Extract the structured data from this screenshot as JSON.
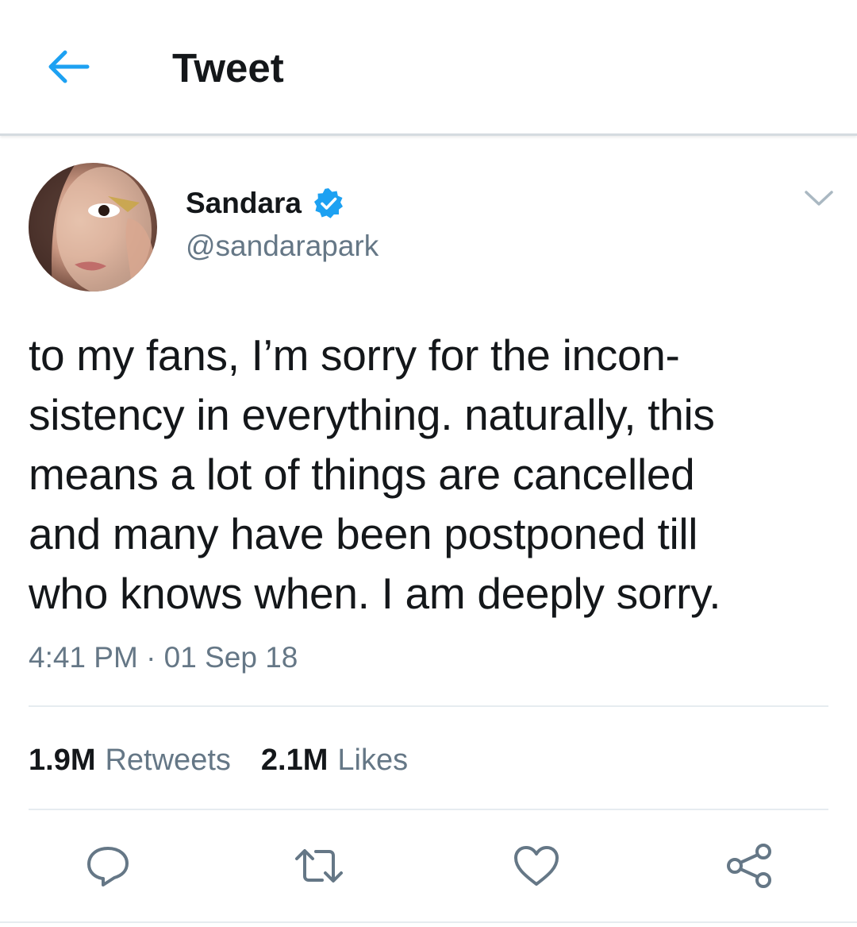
{
  "header": {
    "title": "Tweet",
    "back_icon": "arrow-left-icon",
    "accent_color": "#1da1f2"
  },
  "author": {
    "display_name": "Sandara",
    "handle": "@sandarapark",
    "verified": true,
    "verified_color": "#1da1f2",
    "avatar_icon": "avatar-photo"
  },
  "tweet": {
    "text": "to my fans, I’m sorry for the incon-\nsistency in everything. naturally, this\nmeans a lot of things are cancelled\nand many have been postponed till\nwho knows when. I am deeply sorry.",
    "timestamp": "4:41 PM · 01 Sep 18"
  },
  "stats": {
    "retweets_count": "1.9M",
    "retweets_label": "Retweets",
    "likes_count": "2.1M",
    "likes_label": "Likes"
  },
  "actions": [
    {
      "icon": "reply-icon"
    },
    {
      "icon": "retweet-icon"
    },
    {
      "icon": "like-icon"
    },
    {
      "icon": "share-icon"
    }
  ],
  "colors": {
    "text_primary": "#14171a",
    "text_secondary": "#657786",
    "divider": "#e6ecf0"
  }
}
